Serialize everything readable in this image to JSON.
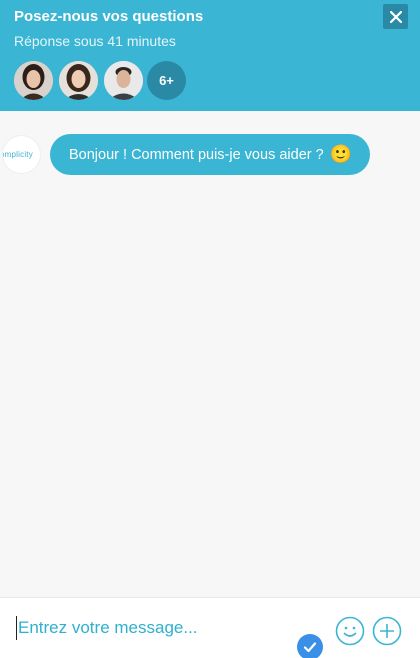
{
  "header": {
    "title": "Posez-nous vos questions",
    "subtitle": "Réponse sous 41 minutes",
    "more_count": "6+",
    "close_icon": "close-icon",
    "accent_color": "#3ab5d3",
    "dark_accent": "#2a8aa6"
  },
  "agents": [
    {
      "name": "agent-1"
    },
    {
      "name": "agent-2"
    },
    {
      "name": "agent-3"
    }
  ],
  "messages": [
    {
      "sender_logo_text": "omplicity",
      "text": "Bonjour ! Comment puis-je vous aider ?",
      "emoji": "🙂"
    }
  ],
  "composer": {
    "placeholder": "Entrez votre message...",
    "emoji_icon": "emoji-icon",
    "add_icon": "plus-icon",
    "status_icon": "check-badge-icon"
  }
}
